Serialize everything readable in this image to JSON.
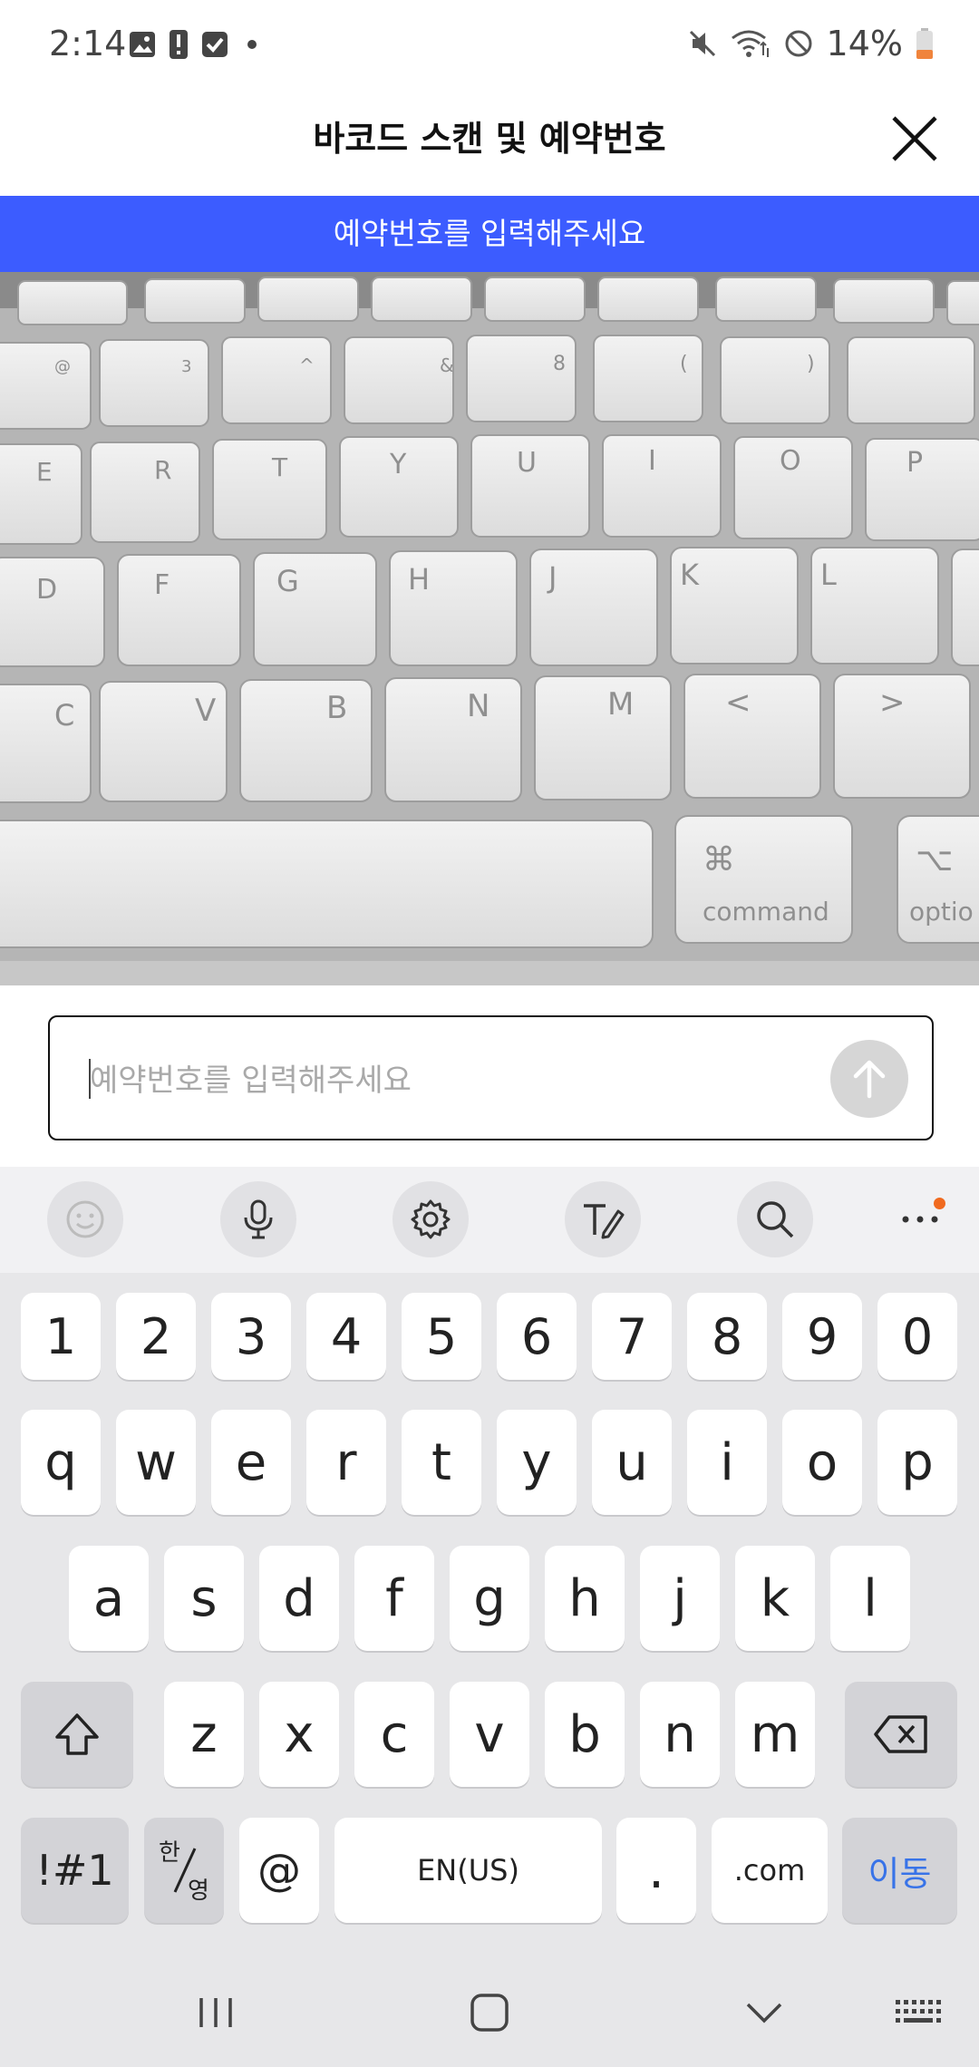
{
  "status_bar": {
    "time": "2:14",
    "battery": "14%",
    "icons_left": [
      "image-icon",
      "alert-icon",
      "check-icon",
      "dot-icon"
    ],
    "icons_right": [
      "mute-icon",
      "wifi-icon",
      "block-icon",
      "battery-icon"
    ]
  },
  "header": {
    "title": "바코드 스캔 및 예약번호"
  },
  "banner": {
    "text": "예약번호를 입력해주세요"
  },
  "input": {
    "placeholder": "예약번호를 입력해주세요",
    "value": ""
  },
  "keyboard": {
    "toolbar": [
      "emoji-icon",
      "mic-icon",
      "settings-icon",
      "handwriting-icon",
      "search-icon",
      "more-icon"
    ],
    "row_numbers": [
      "1",
      "2",
      "3",
      "4",
      "5",
      "6",
      "7",
      "8",
      "9",
      "0"
    ],
    "row_1": [
      "q",
      "w",
      "e",
      "r",
      "t",
      "y",
      "u",
      "i",
      "o",
      "p"
    ],
    "row_2": [
      "a",
      "s",
      "d",
      "f",
      "g",
      "h",
      "j",
      "k",
      "l"
    ],
    "row_3": [
      "z",
      "x",
      "c",
      "v",
      "b",
      "n",
      "m"
    ],
    "symbols_label": "!#1",
    "lang_top": "한",
    "lang_bottom": "영",
    "at_label": "@",
    "space_label": "EN(US)",
    "period_label": ".",
    "dotcom_label": ".com",
    "go_label": "이동"
  },
  "camera_keyboard_labels": {
    "command": "command",
    "option": "optio"
  },
  "colors": {
    "banner": "#3c5cff",
    "go_key": "#3873e8",
    "notification_dot": "#f06a1f"
  }
}
